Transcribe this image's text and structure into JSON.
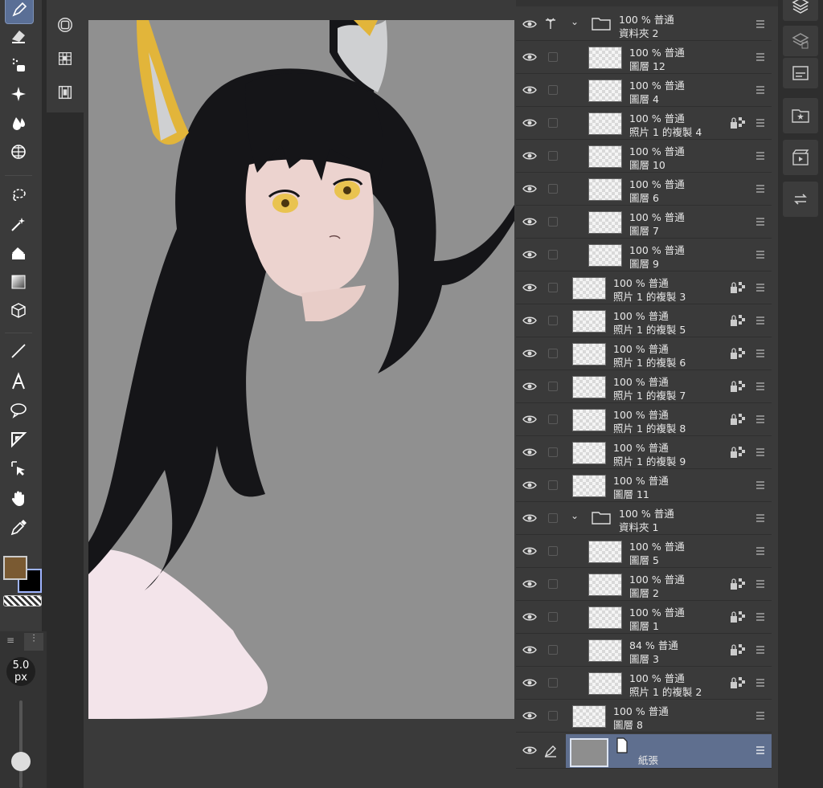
{
  "toolbar": {
    "tools": [
      "pen-icon",
      "eraser-icon",
      "airbrush-icon",
      "decoration-icon",
      "blend-icon",
      "grid-icon",
      "lasso-icon",
      "magic-wand-icon",
      "fill-icon",
      "gradient-icon",
      "3d-icon",
      "line-icon",
      "text-icon",
      "balloon-icon",
      "ruler-icon",
      "object-select-icon",
      "hand-icon",
      "eyedropper-icon"
    ],
    "fg_color": "#7a5a32",
    "bg_color": "#000000"
  },
  "brush": {
    "size": "5.0",
    "unit": "px"
  },
  "layers": [
    {
      "opacity": "100 %",
      "blend": "普通",
      "name": "資料夾 2",
      "type": "folder",
      "indent": 1
    },
    {
      "opacity": "100 %",
      "blend": "普通",
      "name": "圖層 12",
      "type": "layer",
      "indent": 2
    },
    {
      "opacity": "100 %",
      "blend": "普通",
      "name": "圖層 4",
      "type": "layer",
      "indent": 2
    },
    {
      "opacity": "100 %",
      "blend": "普通",
      "name": "照片 1 的複製 4",
      "type": "layer",
      "indent": 2,
      "locked": true
    },
    {
      "opacity": "100 %",
      "blend": "普通",
      "name": "圖層 10",
      "type": "layer",
      "indent": 2
    },
    {
      "opacity": "100 %",
      "blend": "普通",
      "name": "圖層 6",
      "type": "layer",
      "indent": 2
    },
    {
      "opacity": "100 %",
      "blend": "普通",
      "name": "圖層 7",
      "type": "layer",
      "indent": 2
    },
    {
      "opacity": "100 %",
      "blend": "普通",
      "name": "圖層 9",
      "type": "layer",
      "indent": 2
    },
    {
      "opacity": "100 %",
      "blend": "普通",
      "name": "照片 1 的複製 3",
      "type": "layer",
      "indent": 1,
      "locked": true
    },
    {
      "opacity": "100 %",
      "blend": "普通",
      "name": "照片 1 的複製 5",
      "type": "layer",
      "indent": 1,
      "locked": true
    },
    {
      "opacity": "100 %",
      "blend": "普通",
      "name": "照片 1 的複製 6",
      "type": "layer",
      "indent": 1,
      "locked": true
    },
    {
      "opacity": "100 %",
      "blend": "普通",
      "name": "照片 1 的複製 7",
      "type": "layer",
      "indent": 1,
      "locked": true
    },
    {
      "opacity": "100 %",
      "blend": "普通",
      "name": "照片 1 的複製 8",
      "type": "layer",
      "indent": 1,
      "locked": true
    },
    {
      "opacity": "100 %",
      "blend": "普通",
      "name": "照片 1 的複製 9",
      "type": "layer",
      "indent": 1,
      "locked": true
    },
    {
      "opacity": "100 %",
      "blend": "普通",
      "name": "圖層 11",
      "type": "layer",
      "indent": 1
    },
    {
      "opacity": "100 %",
      "blend": "普通",
      "name": "資料夾 1",
      "type": "folder",
      "indent": 1
    },
    {
      "opacity": "100 %",
      "blend": "普通",
      "name": "圖層 5",
      "type": "layer",
      "indent": 2
    },
    {
      "opacity": "100 %",
      "blend": "普通",
      "name": "圖層 2",
      "type": "layer",
      "indent": 2,
      "locked": true
    },
    {
      "opacity": "100 %",
      "blend": "普通",
      "name": "圖層 1",
      "type": "layer",
      "indent": 2,
      "locked": true
    },
    {
      "opacity": "84 %",
      "blend": "普通",
      "name": "圖層 3",
      "type": "layer",
      "indent": 2,
      "locked": true
    },
    {
      "opacity": "100 %",
      "blend": "普通",
      "name": "照片 1 的複製 2",
      "type": "layer",
      "indent": 2,
      "locked": true
    },
    {
      "opacity": "100 %",
      "blend": "普通",
      "name": "圖層 8",
      "type": "layer",
      "indent": 1
    },
    {
      "opacity": "",
      "blend": "",
      "name": "紙張",
      "type": "paper",
      "indent": 1,
      "selected": true
    }
  ],
  "right_panel": [
    "layers-icon",
    "material-icon",
    "sub-view-icon",
    "favorite-icon",
    "animation-icon",
    "history-icon"
  ],
  "colors": {
    "selected_row": "#5f6f8f",
    "canvas_bg": "#909090"
  }
}
